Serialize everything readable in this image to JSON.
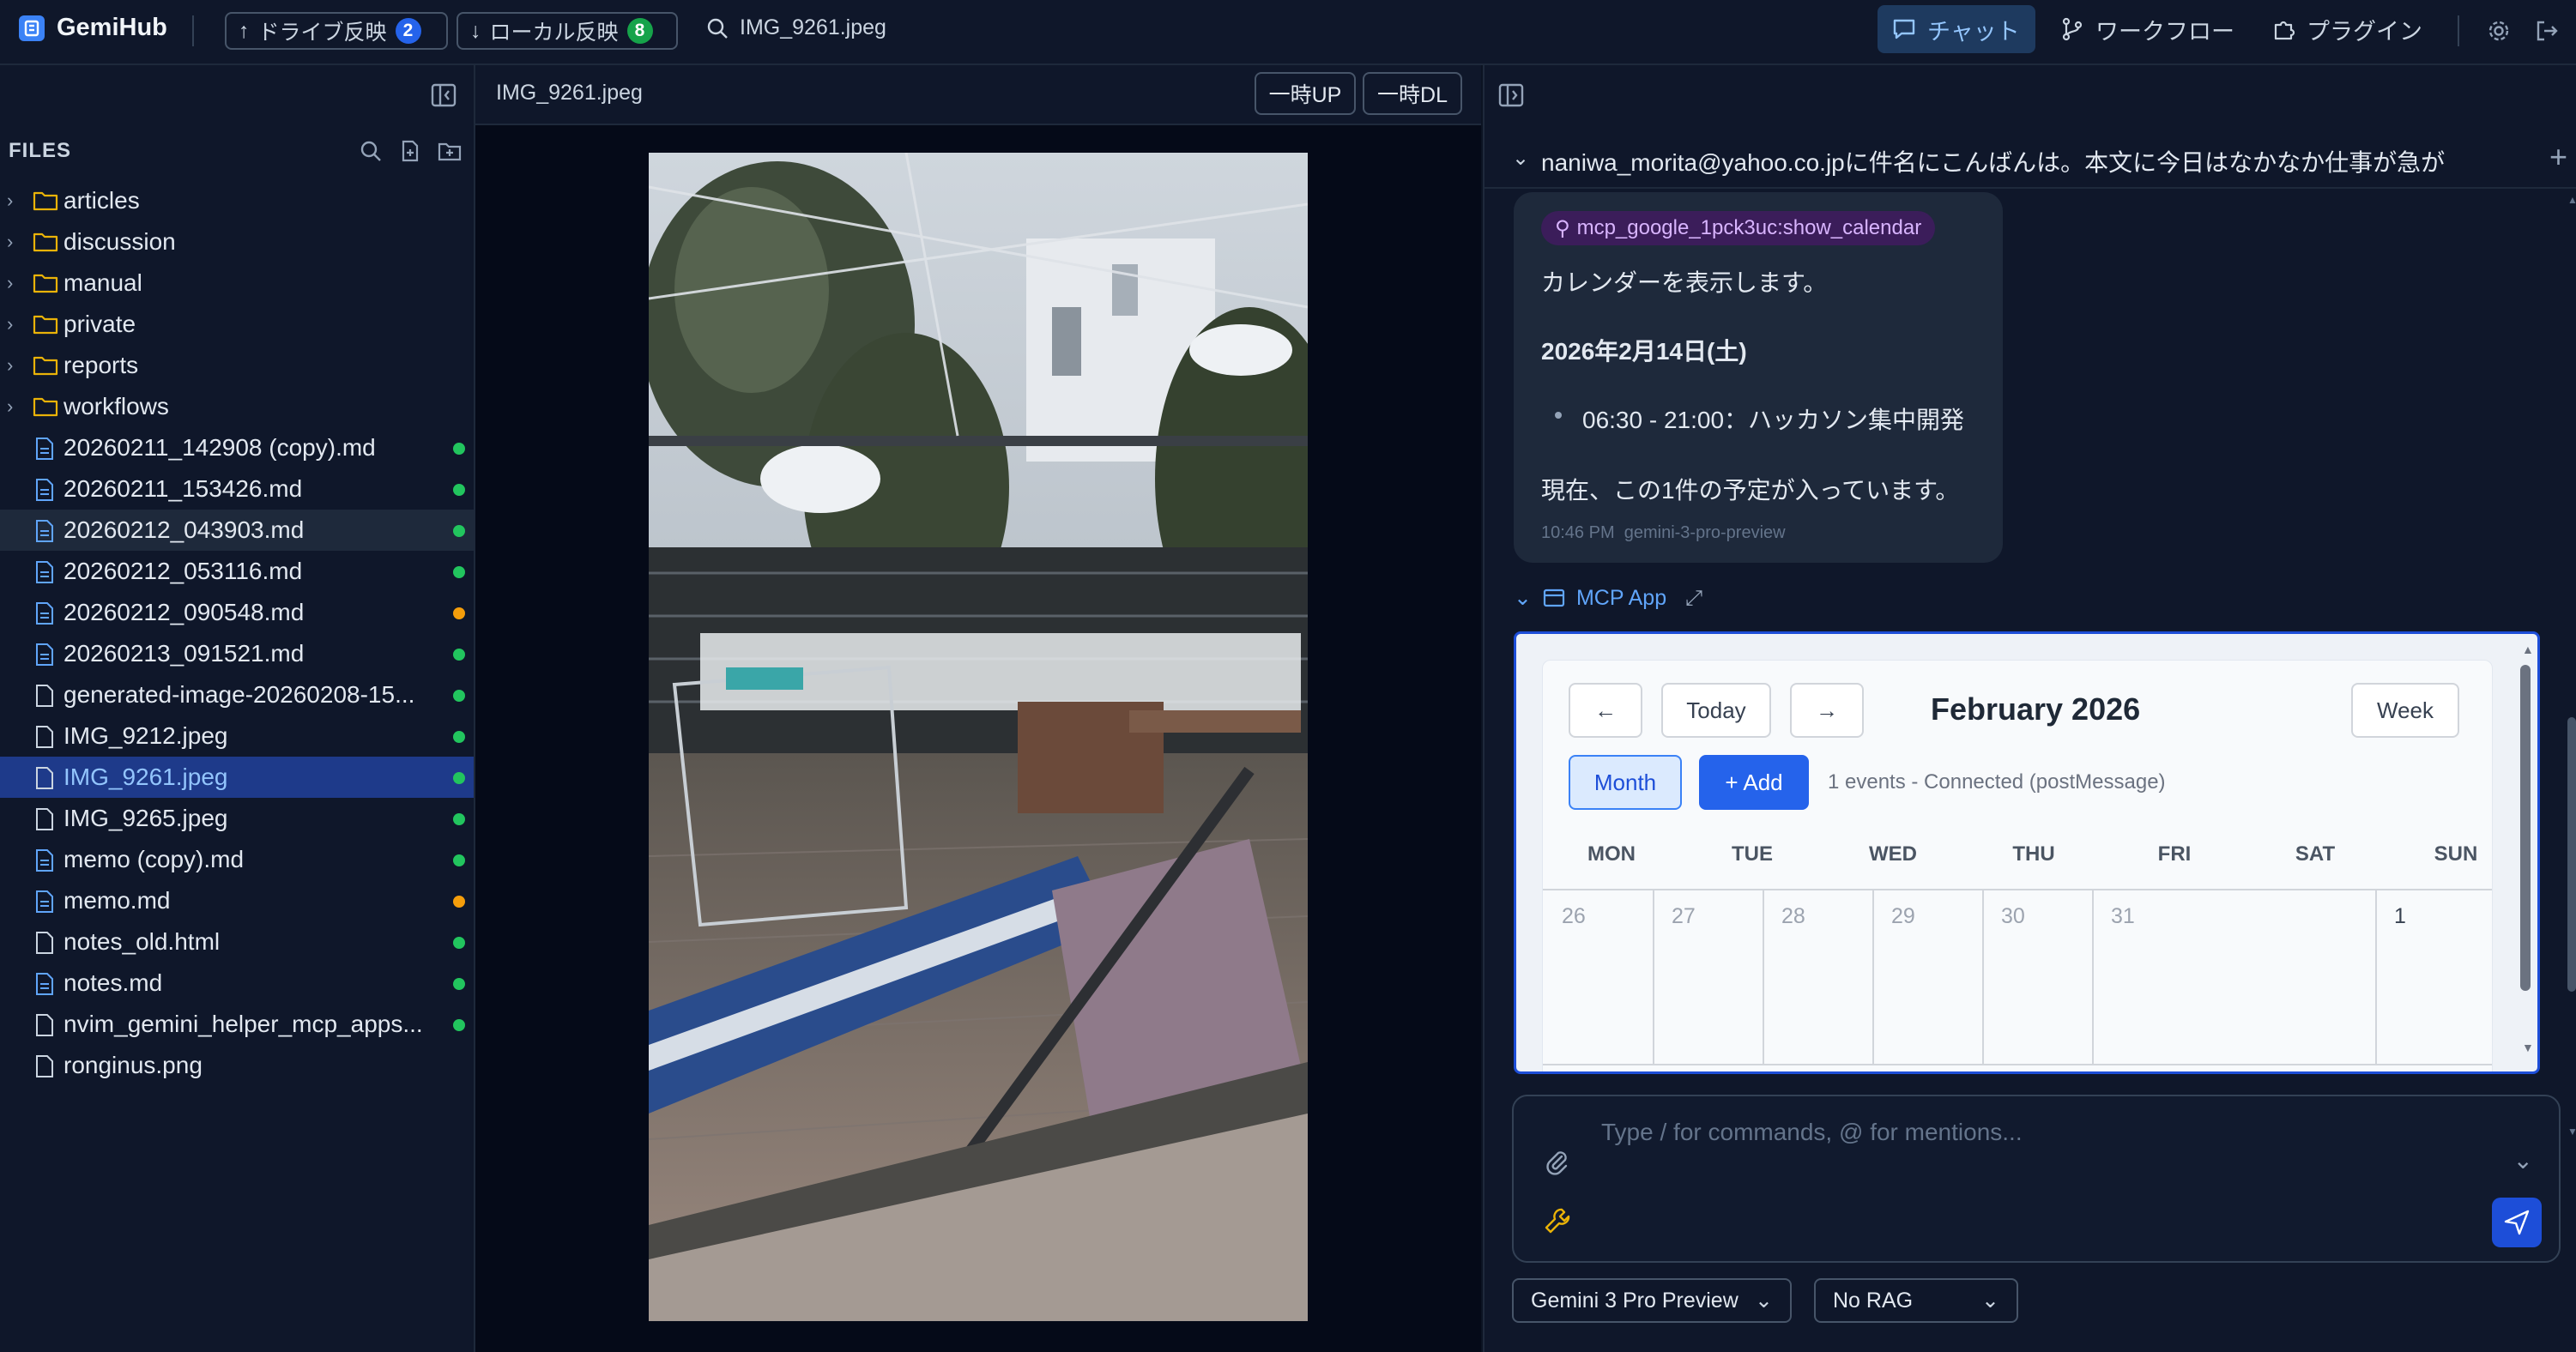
{
  "app": {
    "name": "GemiHub"
  },
  "topbar": {
    "drive_sync": {
      "label": "ドライブ反映",
      "count": "2"
    },
    "local_sync": {
      "label": "ローカル反映",
      "count": "8"
    },
    "search_text": "IMG_9261.jpeg",
    "nav": [
      {
        "label": "チャット",
        "active": true
      },
      {
        "label": "ワークフロー"
      },
      {
        "label": "プラグイン"
      }
    ]
  },
  "sidebar": {
    "title": "FILES",
    "folders": [
      "articles",
      "discussion",
      "manual",
      "private",
      "reports",
      "workflows"
    ],
    "files": [
      {
        "name": "20260211_142908 (copy).md",
        "type": "md",
        "status": "green"
      },
      {
        "name": "20260211_153426.md",
        "type": "md",
        "status": "green"
      },
      {
        "name": "20260212_043903.md",
        "type": "md",
        "status": "green",
        "hover": true
      },
      {
        "name": "20260212_053116.md",
        "type": "md",
        "status": "green"
      },
      {
        "name": "20260212_090548.md",
        "type": "md",
        "status": "orange"
      },
      {
        "name": "20260213_091521.md",
        "type": "md",
        "status": "green"
      },
      {
        "name": "generated-image-20260208-15...",
        "type": "file",
        "status": "green"
      },
      {
        "name": "IMG_9212.jpeg",
        "type": "file",
        "status": "green"
      },
      {
        "name": "IMG_9261.jpeg",
        "type": "file",
        "status": "green",
        "selected": true
      },
      {
        "name": "IMG_9265.jpeg",
        "type": "file",
        "status": "green"
      },
      {
        "name": "memo (copy).md",
        "type": "md",
        "status": "green"
      },
      {
        "name": "memo.md",
        "type": "md",
        "status": "orange"
      },
      {
        "name": "notes_old.html",
        "type": "file",
        "status": "green"
      },
      {
        "name": "notes.md",
        "type": "md",
        "status": "green"
      },
      {
        "name": "nvim_gemini_helper_mcp_apps...",
        "type": "file",
        "status": "green"
      },
      {
        "name": "ronginus.png",
        "type": "file",
        "status": ""
      }
    ]
  },
  "viewer": {
    "title": "IMG_9261.jpeg",
    "temp_upload": "一時UP",
    "temp_download": "一時DL"
  },
  "chat": {
    "thread_title": "naniwa_morita@yahoo.co.jpに件名にこんばんは。本文に今日はなかなか仕事が急が",
    "message": {
      "tool": "mcp_google_1pck3uc:show_calendar",
      "line1": "カレンダーを表示します。",
      "date": "2026年2月14日(土)",
      "event": "06:30 - 21:00：ハッカソン集中開発",
      "summary": "現在、この1件の予定が入っています。",
      "time": "10:46 PM",
      "model": "gemini-3-pro-preview"
    },
    "mcp_app": {
      "label": "MCP App",
      "calendar": {
        "prev": "←",
        "today": "Today",
        "next": "→",
        "title": "February 2026",
        "week": "Week",
        "month": "Month",
        "add": "+ Add",
        "status": "1 events - Connected (postMessage)",
        "days": [
          "MON",
          "TUE",
          "WED",
          "THU",
          "FRI",
          "SAT",
          "SUN"
        ],
        "first_row": [
          "26",
          "27",
          "28",
          "29",
          "30",
          "31",
          "1"
        ]
      }
    },
    "composer": {
      "placeholder": "Type / for commands, @ for mentions..."
    },
    "model_select": "Gemini 3 Pro Preview",
    "rag_select": "No RAG"
  },
  "colors": {
    "green": "#22c55e",
    "orange": "#f59e0b",
    "accent": "#2563eb"
  }
}
